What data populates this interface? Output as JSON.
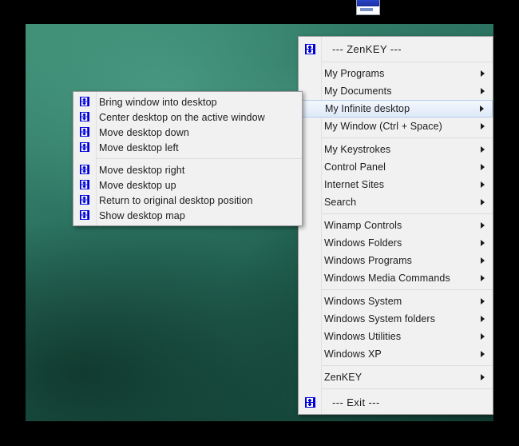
{
  "desktop": {
    "wallpaper_color": "#2e7a63",
    "top_window_fragment": {
      "name": "minimized-window-fragment"
    },
    "bottom_strip": {
      "name": "desktop-edge-strip"
    }
  },
  "main_menu": {
    "title": {
      "label": "---  ZenKEY  ---",
      "icon": "zenkey-icon"
    },
    "groups": [
      {
        "items": [
          {
            "label": "My Programs",
            "arrow": true
          },
          {
            "label": "My Documents",
            "arrow": true
          },
          {
            "label": "My Infinite desktop",
            "arrow": true,
            "selected": true
          },
          {
            "label": "My Window (Ctrl + Space)",
            "arrow": true
          }
        ]
      },
      {
        "items": [
          {
            "label": "My Keystrokes",
            "arrow": true
          },
          {
            "label": "Control Panel",
            "arrow": true
          },
          {
            "label": "Internet Sites",
            "arrow": true
          },
          {
            "label": "Search",
            "arrow": true
          }
        ]
      },
      {
        "items": [
          {
            "label": "Winamp Controls",
            "arrow": true
          },
          {
            "label": "Windows Folders",
            "arrow": true
          },
          {
            "label": "Windows Programs",
            "arrow": true
          },
          {
            "label": "Windows Media Commands",
            "arrow": true
          }
        ]
      },
      {
        "items": [
          {
            "label": "Windows System",
            "arrow": true
          },
          {
            "label": "Windows System folders",
            "arrow": true
          },
          {
            "label": "Windows Utilities",
            "arrow": true
          },
          {
            "label": "Windows XP",
            "arrow": true
          }
        ]
      },
      {
        "items": [
          {
            "label": "ZenKEY",
            "arrow": true
          }
        ]
      }
    ],
    "exit": {
      "label": "---  Exit  ---",
      "icon": "zenkey-icon"
    }
  },
  "sub_menu": {
    "groups": [
      {
        "items": [
          {
            "label": "Bring window into desktop",
            "icon": "zenkey-icon"
          },
          {
            "label": "Center desktop on the active window",
            "icon": "zenkey-icon"
          },
          {
            "label": "Move desktop down",
            "icon": "zenkey-icon"
          },
          {
            "label": "Move desktop left",
            "icon": "zenkey-icon"
          }
        ]
      },
      {
        "items": [
          {
            "label": "Move desktop right",
            "icon": "zenkey-icon"
          },
          {
            "label": "Move desktop up",
            "icon": "zenkey-icon"
          },
          {
            "label": "Return to original desktop position",
            "icon": "zenkey-icon"
          },
          {
            "label": "Show desktop map",
            "icon": "zenkey-icon"
          }
        ]
      }
    ]
  },
  "colors": {
    "menu_background": "#f1f1f1",
    "menu_border": "#9d9d9d",
    "separator": "#dcdcdc",
    "selected_border": "#b5cdec",
    "icon_blue": "#0000dd",
    "text": "#1b1b1b"
  }
}
